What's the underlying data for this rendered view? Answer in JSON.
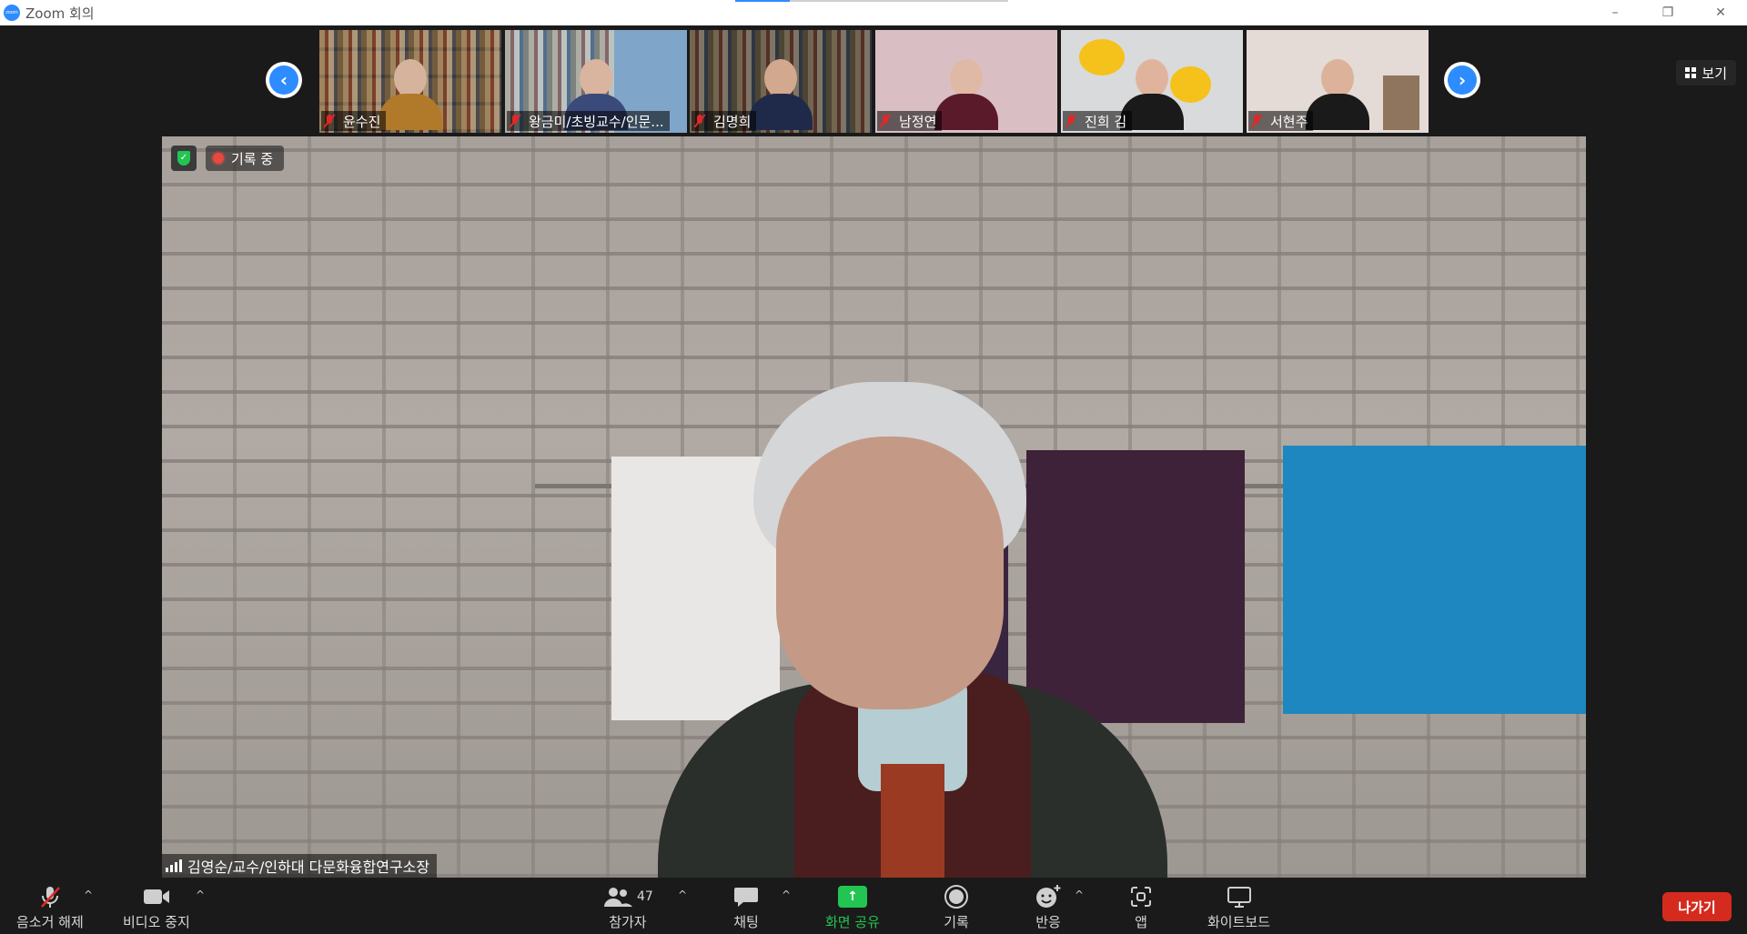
{
  "window": {
    "title": "Zoom 회의",
    "logo_text": "zoom",
    "controls": {
      "minimize": "–",
      "restore": "❐",
      "close": "✕"
    }
  },
  "filmstrip": {
    "prev_arrow": "‹",
    "next_arrow": "›",
    "participants": [
      {
        "name": "윤수진",
        "muted": true
      },
      {
        "name": "왕금미/초빙교수/인문...",
        "muted": true
      },
      {
        "name": "김명희",
        "muted": true
      },
      {
        "name": "남정연",
        "muted": true
      },
      {
        "name": "진희 김",
        "muted": true
      },
      {
        "name": "서현주",
        "muted": true
      }
    ],
    "view_label": "보기"
  },
  "main_video": {
    "recording_label": "기록 중",
    "speaker_name": "김영순/교수/인하대 다문화융합연구소장"
  },
  "toolbar": {
    "unmute": "음소거 해제",
    "stop_video": "비디오 중지",
    "participants": "참가자",
    "participants_count": "47",
    "chat": "채팅",
    "share_screen": "화면 공유",
    "record": "기록",
    "reactions": "반응",
    "apps": "앱",
    "whiteboard": "화이트보드",
    "leave": "나가기",
    "caret": "^"
  },
  "colors": {
    "accent": "#2d8cff",
    "share_green": "#23c552",
    "leave_red": "#d52b1e",
    "mute_red": "#e02828"
  }
}
